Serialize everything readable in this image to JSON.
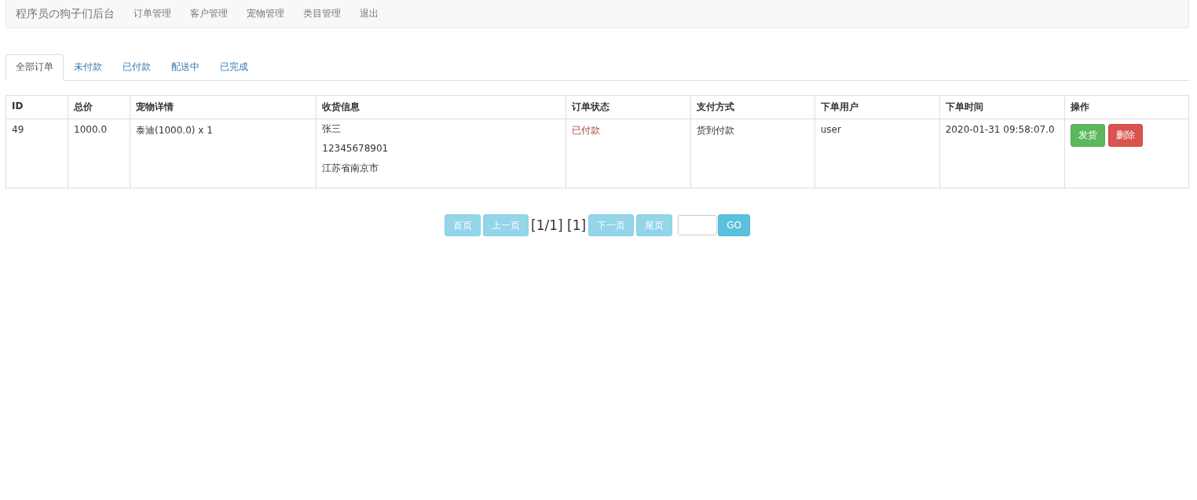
{
  "navbar": {
    "brand": "程序员の狗子们后台",
    "items": [
      "订单管理",
      "客户管理",
      "宠物管理",
      "类目管理",
      "退出"
    ]
  },
  "tabs": [
    {
      "label": "全部订单",
      "selected": true
    },
    {
      "label": "未付款",
      "selected": false
    },
    {
      "label": "已付款",
      "selected": false
    },
    {
      "label": "配送中",
      "selected": false
    },
    {
      "label": "已完成",
      "selected": false
    }
  ],
  "table": {
    "columns": [
      "ID",
      "总价",
      "宠物详情",
      "收货信息",
      "订单状态",
      "支付方式",
      "下单用户",
      "下单时间",
      "操作"
    ],
    "rows": [
      {
        "id": "49",
        "total": "1000.0",
        "pets": "泰迪(1000.0) x 1",
        "shipping": [
          "张三",
          "12345678901",
          "江苏省南京市"
        ],
        "status": {
          "text": "已付款",
          "kind": "danger"
        },
        "payment": "货到付款",
        "user": "user",
        "time": "2020-01-31 09:58:07.0",
        "actions": [
          {
            "label": "发货",
            "kind": "success"
          },
          {
            "label": "删除",
            "kind": "danger"
          }
        ]
      }
    ]
  },
  "pager": {
    "first": {
      "label": "首页",
      "disabled": true
    },
    "prev": {
      "label": "上一页",
      "disabled": true
    },
    "info": "[1/1] [1]",
    "next": {
      "label": "下一页",
      "disabled": true
    },
    "last": {
      "label": "尾页",
      "disabled": true
    },
    "go": {
      "label": "GO",
      "disabled": false
    }
  }
}
